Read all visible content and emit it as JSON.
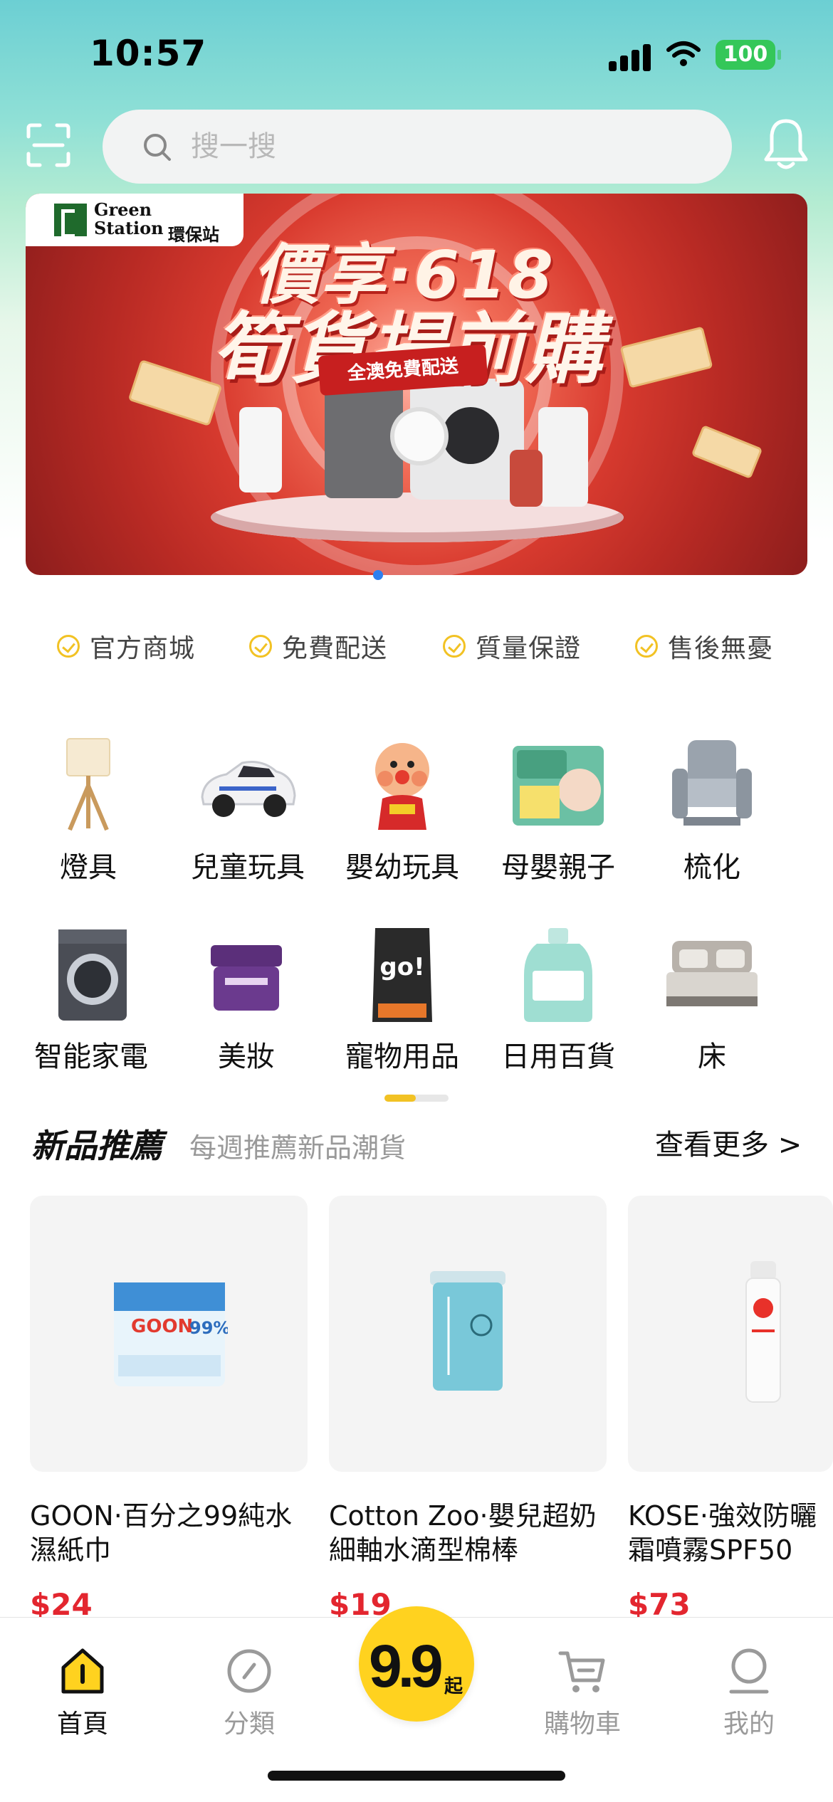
{
  "status_bar": {
    "time": "10:57",
    "battery": "100"
  },
  "search": {
    "placeholder": "搜一搜"
  },
  "banner": {
    "brand_en_1": "Green",
    "brand_en_2": "Station",
    "brand_cn": "環保站",
    "headline_1": "價享·618",
    "headline_2": "筍貨提前購",
    "ribbon": "全澳免費配送"
  },
  "guarantees": [
    "官方商城",
    "免費配送",
    "質量保證",
    "售後無憂"
  ],
  "categories": [
    {
      "label": "燈具",
      "icon": "lamp-icon"
    },
    {
      "label": "兒童玩具",
      "icon": "toy-car-icon"
    },
    {
      "label": "嬰幼玩具",
      "icon": "baby-toy-icon"
    },
    {
      "label": "母嬰親子",
      "icon": "diaper-icon"
    },
    {
      "label": "梳化",
      "icon": "sofa-icon"
    },
    {
      "label": "智能家電",
      "icon": "washing-machine-icon"
    },
    {
      "label": "美妝",
      "icon": "cosmetic-jar-icon"
    },
    {
      "label": "寵物用品",
      "icon": "pet-food-icon"
    },
    {
      "label": "日用百貨",
      "icon": "shampoo-icon"
    },
    {
      "label": "床",
      "icon": "bed-icon"
    }
  ],
  "new_products": {
    "title": "新品推薦",
    "subtitle": "每週推薦新品潮貨",
    "see_more": "查看更多 >",
    "items": [
      {
        "name": "GOON·百分之99純水濕紙巾",
        "price": "$24"
      },
      {
        "name": "Cotton Zoo·嬰兒超奶細軸水滴型棉棒",
        "price": "$19"
      },
      {
        "name": "KOSE·強效防曬霜噴霧SPF50",
        "price": "$73"
      }
    ]
  },
  "bottom_nav": {
    "items": [
      {
        "label": "首頁",
        "active": true
      },
      {
        "label": "分類",
        "active": false
      },
      {
        "label": "購物車",
        "active": false
      },
      {
        "label": "我的",
        "active": false
      }
    ],
    "center_value": "9.9",
    "center_suffix": "起"
  },
  "colors": {
    "accent": "#f2c224",
    "price": "#e3262f",
    "banner_red": "#d93b2f"
  }
}
